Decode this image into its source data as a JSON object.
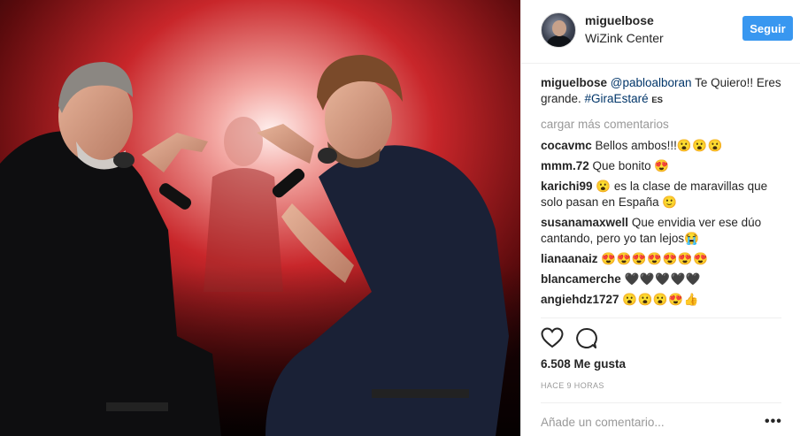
{
  "header": {
    "username": "miguelbose",
    "location": "WiZink Center",
    "follow_label": "Seguir"
  },
  "caption": {
    "username": "miguelbose",
    "mention": "@pabloalboran",
    "text_1": " Te Quiero!! Eres grande. ",
    "hashtag": "#GiraEstaré",
    "translate": " ES"
  },
  "load_more": "cargar más comentarios",
  "comments": [
    {
      "user": "cocavmc",
      "text": " Bellos ambos!!!",
      "emoji": "😮😮😮"
    },
    {
      "user": "mmm.72",
      "text": " Que bonito ",
      "emoji": "😍"
    },
    {
      "user": "karichi99",
      "text": " 😮 es la clase de maravillas que solo pasan en España ",
      "emoji": "🙂"
    },
    {
      "user": "susanamaxwell",
      "text": " Que envidia ver ese dúo cantando, pero yo tan lejos",
      "emoji": "😭"
    },
    {
      "user": "lianaanaiz",
      "text": " ",
      "emoji": "😍😍😍😍😍😍😍"
    },
    {
      "user": "blancamerche",
      "text": " ",
      "emoji": "🖤🖤🖤🖤🖤"
    },
    {
      "user": "angiehdz1727",
      "text": " ",
      "emoji": "😮😮😮😍👍"
    }
  ],
  "likes": "6.508 Me gusta",
  "timestamp": "HACE 9 HORAS",
  "add_comment_placeholder": "Añade un comentario...",
  "more_options": "•••",
  "icons": {
    "like": "heart-icon",
    "comment": "comment-bubble-icon"
  }
}
